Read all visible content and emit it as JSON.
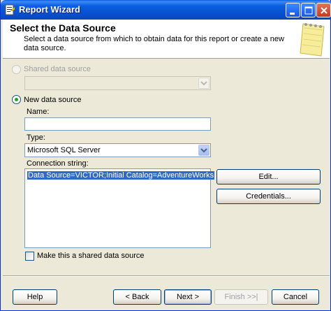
{
  "window": {
    "title": "Report Wizard"
  },
  "header": {
    "title": "Select the Data Source",
    "subtitle": "Select a data source from which to obtain data for this report or create a new data source."
  },
  "shared_source": {
    "label": "Shared data source",
    "selected": false,
    "enabled": false,
    "combo_value": ""
  },
  "new_source": {
    "label": "New data source",
    "selected": true,
    "name_label": "Name:",
    "name_value": "",
    "type_label": "Type:",
    "type_value": "Microsoft SQL Server",
    "connection_label": "Connection string:",
    "connection_value": "Data Source=VICTOR;Initial Catalog=AdventureWorks",
    "edit_button": "Edit...",
    "credentials_button": "Credentials...",
    "make_shared_label": "Make this a shared data source",
    "make_shared_checked": false
  },
  "footer": {
    "help": "Help",
    "back": "< Back",
    "next": "Next >",
    "finish": "Finish >>|",
    "cancel": "Cancel"
  },
  "colors": {
    "titlebar": "#0a5fe0",
    "dialog_bg": "#ece9d8",
    "selection": "#316ac5",
    "radio_dot": "#21a121"
  },
  "icons": {
    "app": "report-wizard-icon",
    "minimize": "minimize-icon",
    "maximize": "maximize-icon",
    "close": "close-icon",
    "header_art": "notepad-icon",
    "dropdown": "chevron-down-icon"
  }
}
